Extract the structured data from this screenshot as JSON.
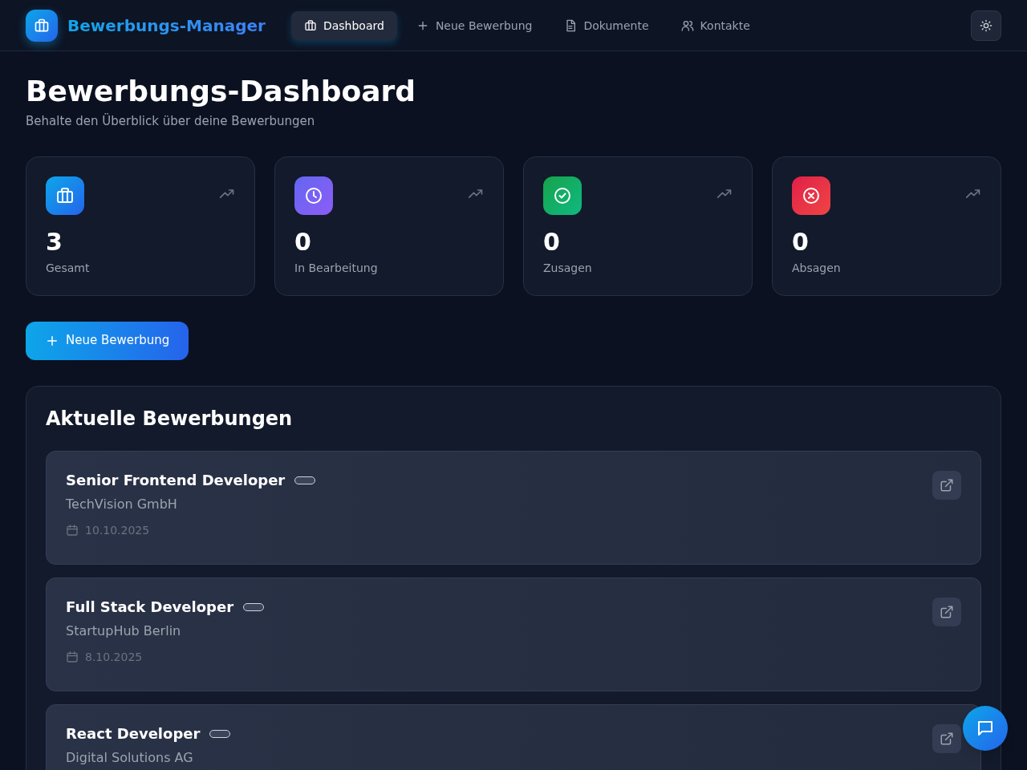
{
  "app": {
    "title": "Bewerbungs-Manager"
  },
  "nav": [
    {
      "label": "Dashboard",
      "kind": "briefcase",
      "selected": true
    },
    {
      "label": "Neue Bewerbung",
      "kind": "plus",
      "selected": false
    },
    {
      "label": "Dokumente",
      "kind": "document",
      "selected": false
    },
    {
      "label": "Kontakte",
      "kind": "users",
      "selected": false
    }
  ],
  "page": {
    "title": "Bewerbungs-Dashboard",
    "subtitle": "Behalte den Überblick über deine Bewerbungen"
  },
  "stats": [
    {
      "kind": "total",
      "value": "3",
      "label": "Gesamt"
    },
    {
      "kind": "progress",
      "value": "0",
      "label": "In Bearbeitung"
    },
    {
      "kind": "accepted",
      "value": "0",
      "label": "Zusagen"
    },
    {
      "kind": "rejected",
      "value": "0",
      "label": "Absagen"
    }
  ],
  "new_button": {
    "label": "Neue Bewerbung"
  },
  "applications": {
    "title": "Aktuelle Bewerbungen",
    "items": [
      {
        "position": "Senior Frontend Developer",
        "company": "TechVision GmbH",
        "date": "10.10.2025"
      },
      {
        "position": "Full Stack Developer",
        "company": "StartupHub Berlin",
        "date": "8.10.2025"
      },
      {
        "position": "React Developer",
        "company": "Digital Solutions AG"
      }
    ]
  }
}
